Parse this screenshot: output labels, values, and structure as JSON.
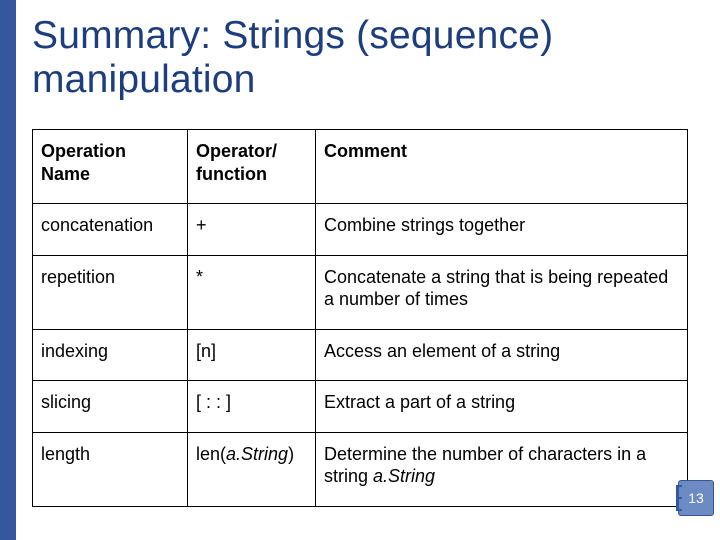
{
  "title": "Summary: Strings (sequence) manipulation",
  "headers": {
    "name": "Operation Name",
    "op": "Operator/ function",
    "comment": "Comment"
  },
  "rows": [
    {
      "name": "concatenation",
      "op": "+",
      "comment": "Combine strings together"
    },
    {
      "name": "repetition",
      "op": "*",
      "comment": "Concatenate a string that is being repeated a number of times"
    },
    {
      "name": "indexing",
      "op": "[n]",
      "comment": "Access an element of a string"
    },
    {
      "name": "slicing",
      "op": "[ : : ]",
      "comment": "Extract a part of a string"
    },
    {
      "name": "length",
      "op_prefix": "len(",
      "op_arg": "a.String",
      "op_suffix": ")",
      "comment_prefix": "Determine the number of characters in a string ",
      "comment_arg": "a.String"
    }
  ],
  "page_number": "13"
}
